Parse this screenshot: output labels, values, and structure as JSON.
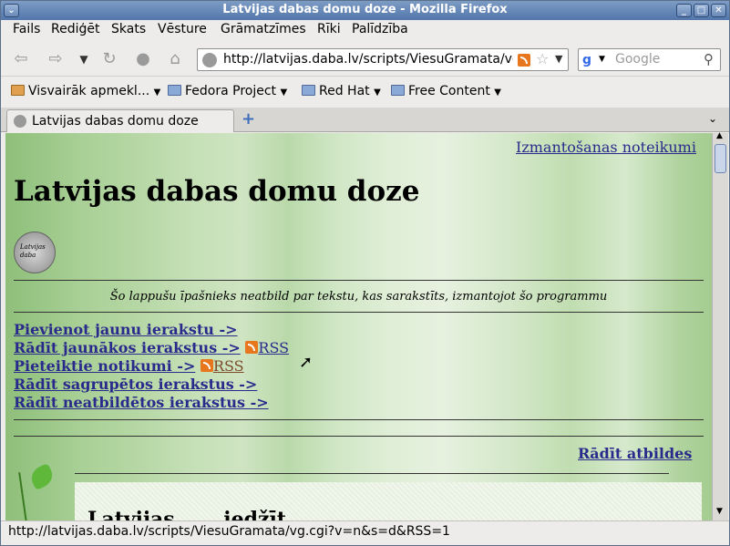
{
  "window": {
    "title": "Latvijas dabas domu doze - Mozilla Firefox"
  },
  "menu": [
    "Fails",
    "Rediģēt",
    "Skats",
    "Vēsture",
    "Grāmatzīmes",
    "Rīki",
    "Palīdzība"
  ],
  "nav": {
    "url": "http://latvijas.daba.lv/scripts/ViesuGramata/vg.c",
    "search_placeholder": "Google"
  },
  "bookmarks": [
    "Visvairāk apmekl...",
    "Fedora Project",
    "Red Hat",
    "Free Content"
  ],
  "tabs": [
    {
      "label": "Latvijas dabas domu doze"
    }
  ],
  "page": {
    "terms_link": "Izmantošanas noteikumi",
    "heading": "Latvijas dabas domu doze",
    "logo_text": "Latvijas daba",
    "disclaimer": "Šo lappušu īpašnieks neatbild par tekstu, kas sarakstīts, izmantojot šo programmu",
    "links": {
      "add": "Pievienot jaunu ierakstu ->",
      "newest": "Rādīt jaunākos ierakstus ->",
      "rss": "RSS",
      "events": "Pieteiktie notikumi ->",
      "rss2": "RSS",
      "sorted": "Rādīt sagrupētos ierakstus ->",
      "unanswered": "Rādīt neatbildētos ierakstus ->"
    },
    "show_answers": "Rādīt atbildes",
    "entry_partial": "Latvijas...  ...iedžīt"
  },
  "status": {
    "text": "http://latvijas.daba.lv/scripts/ViesuGramata/vg.cgi?v=n&s=d&RSS=1"
  }
}
